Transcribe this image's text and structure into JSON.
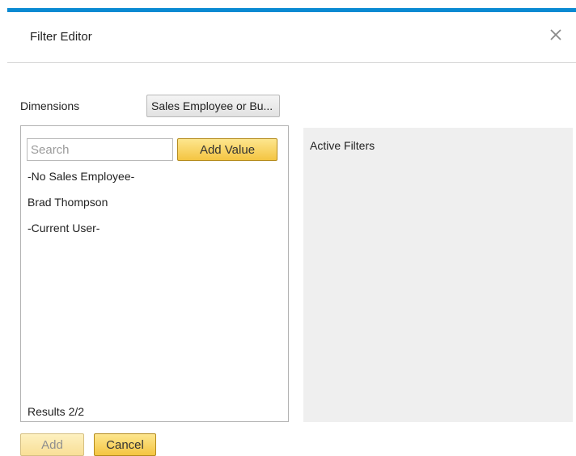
{
  "dialog": {
    "title": "Filter Editor",
    "close_icon": "close-icon"
  },
  "dimensions": {
    "label": "Dimensions",
    "selected": "Sales Employee or Bu..."
  },
  "values_panel": {
    "search_placeholder": "Search",
    "search_value": "",
    "add_value_label": "Add Value",
    "items": [
      {
        "label": "-No Sales Employee-"
      },
      {
        "label": "Brad Thompson"
      },
      {
        "label": "-Current User-"
      }
    ],
    "results": "Results 2/2"
  },
  "active_filters": {
    "title": "Active Filters"
  },
  "footer": {
    "add_label": "Add",
    "cancel_label": "Cancel"
  },
  "colors": {
    "accent": "#0a8ad2",
    "button_yellow": "#f4c542",
    "panel_gray": "#efefef"
  }
}
